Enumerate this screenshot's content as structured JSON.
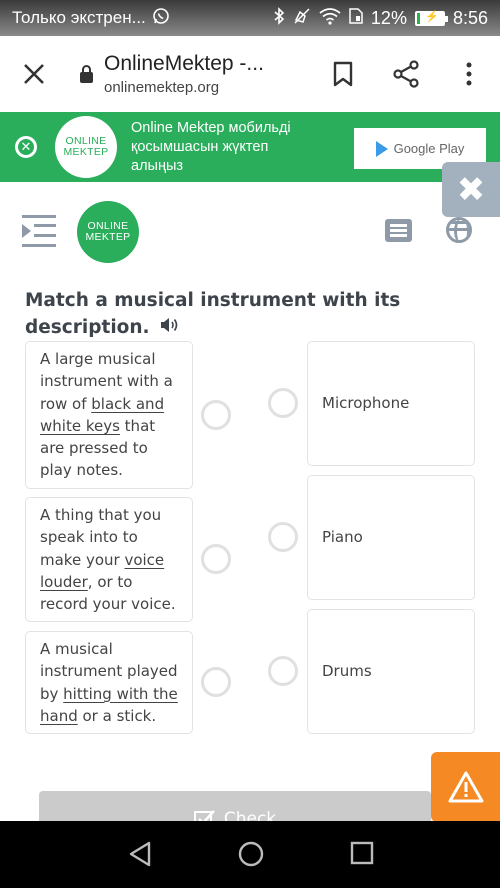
{
  "status_bar": {
    "notification_text": "Только экстрен...",
    "battery_percent": "12%",
    "battery_level": 0.12,
    "time": "8:56",
    "icons": [
      "whatsapp-icon",
      "bluetooth-icon",
      "mute-icon",
      "wifi-icon",
      "sim-icon",
      "battery-charging-icon"
    ]
  },
  "browser": {
    "page_title": "OnlineMektep -...",
    "url": "onlinemektep.org",
    "icons": [
      "close-icon",
      "lock-icon",
      "bookmark-icon",
      "share-icon",
      "more-vert-icon"
    ]
  },
  "app_banner": {
    "logo_line1": "ONLINE",
    "logo_line2": "MEKTEP",
    "message": "Online Mektep мобильді қосымшасын жүктеп алыңыз",
    "store_button": "Google Play"
  },
  "app_header": {
    "logo_line1": "ONLINE",
    "logo_line2": "MEKTEP"
  },
  "question": {
    "text": "Match a musical instrument with its description."
  },
  "descriptions": [
    {
      "before": "A large musical instrument with a row of ",
      "underlined": "black and white keys",
      "after": " that are pressed to play notes."
    },
    {
      "before": "A thing that you speak into to make your ",
      "underlined": "voice louder",
      "after": ", or to record your voice."
    },
    {
      "before": "A musical instrument played by ",
      "underlined": "hitting with the hand",
      "after": " or a stick."
    }
  ],
  "options": [
    {
      "label": "Microphone"
    },
    {
      "label": "Piano"
    },
    {
      "label": "Drums"
    }
  ],
  "footer": {
    "check_label": "Check"
  },
  "colors": {
    "brand_green": "#2aae5b",
    "warning_orange": "#f58a24",
    "icon_gray": "#8e9aa8",
    "disabled_button": "#cbcbcb"
  }
}
